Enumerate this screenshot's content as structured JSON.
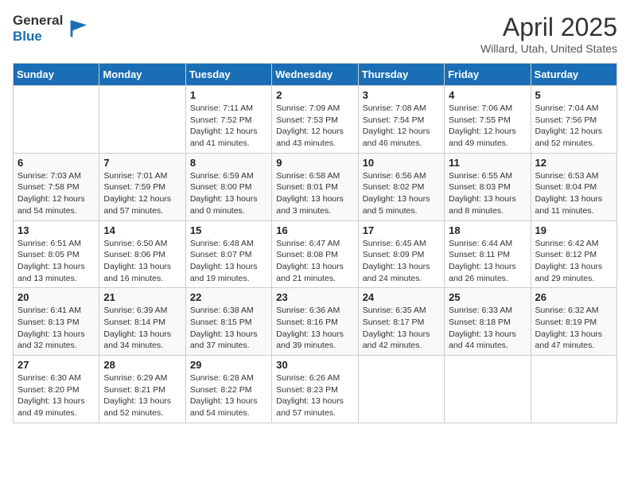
{
  "logo": {
    "line1": "General",
    "line2": "Blue"
  },
  "title": "April 2025",
  "subtitle": "Willard, Utah, United States",
  "days_of_week": [
    "Sunday",
    "Monday",
    "Tuesday",
    "Wednesday",
    "Thursday",
    "Friday",
    "Saturday"
  ],
  "weeks": [
    [
      {
        "num": "",
        "detail": ""
      },
      {
        "num": "",
        "detail": ""
      },
      {
        "num": "1",
        "detail": "Sunrise: 7:11 AM\nSunset: 7:52 PM\nDaylight: 12 hours and 41 minutes."
      },
      {
        "num": "2",
        "detail": "Sunrise: 7:09 AM\nSunset: 7:53 PM\nDaylight: 12 hours and 43 minutes."
      },
      {
        "num": "3",
        "detail": "Sunrise: 7:08 AM\nSunset: 7:54 PM\nDaylight: 12 hours and 46 minutes."
      },
      {
        "num": "4",
        "detail": "Sunrise: 7:06 AM\nSunset: 7:55 PM\nDaylight: 12 hours and 49 minutes."
      },
      {
        "num": "5",
        "detail": "Sunrise: 7:04 AM\nSunset: 7:56 PM\nDaylight: 12 hours and 52 minutes."
      }
    ],
    [
      {
        "num": "6",
        "detail": "Sunrise: 7:03 AM\nSunset: 7:58 PM\nDaylight: 12 hours and 54 minutes."
      },
      {
        "num": "7",
        "detail": "Sunrise: 7:01 AM\nSunset: 7:59 PM\nDaylight: 12 hours and 57 minutes."
      },
      {
        "num": "8",
        "detail": "Sunrise: 6:59 AM\nSunset: 8:00 PM\nDaylight: 13 hours and 0 minutes."
      },
      {
        "num": "9",
        "detail": "Sunrise: 6:58 AM\nSunset: 8:01 PM\nDaylight: 13 hours and 3 minutes."
      },
      {
        "num": "10",
        "detail": "Sunrise: 6:56 AM\nSunset: 8:02 PM\nDaylight: 13 hours and 5 minutes."
      },
      {
        "num": "11",
        "detail": "Sunrise: 6:55 AM\nSunset: 8:03 PM\nDaylight: 13 hours and 8 minutes."
      },
      {
        "num": "12",
        "detail": "Sunrise: 6:53 AM\nSunset: 8:04 PM\nDaylight: 13 hours and 11 minutes."
      }
    ],
    [
      {
        "num": "13",
        "detail": "Sunrise: 6:51 AM\nSunset: 8:05 PM\nDaylight: 13 hours and 13 minutes."
      },
      {
        "num": "14",
        "detail": "Sunrise: 6:50 AM\nSunset: 8:06 PM\nDaylight: 13 hours and 16 minutes."
      },
      {
        "num": "15",
        "detail": "Sunrise: 6:48 AM\nSunset: 8:07 PM\nDaylight: 13 hours and 19 minutes."
      },
      {
        "num": "16",
        "detail": "Sunrise: 6:47 AM\nSunset: 8:08 PM\nDaylight: 13 hours and 21 minutes."
      },
      {
        "num": "17",
        "detail": "Sunrise: 6:45 AM\nSunset: 8:09 PM\nDaylight: 13 hours and 24 minutes."
      },
      {
        "num": "18",
        "detail": "Sunrise: 6:44 AM\nSunset: 8:11 PM\nDaylight: 13 hours and 26 minutes."
      },
      {
        "num": "19",
        "detail": "Sunrise: 6:42 AM\nSunset: 8:12 PM\nDaylight: 13 hours and 29 minutes."
      }
    ],
    [
      {
        "num": "20",
        "detail": "Sunrise: 6:41 AM\nSunset: 8:13 PM\nDaylight: 13 hours and 32 minutes."
      },
      {
        "num": "21",
        "detail": "Sunrise: 6:39 AM\nSunset: 8:14 PM\nDaylight: 13 hours and 34 minutes."
      },
      {
        "num": "22",
        "detail": "Sunrise: 6:38 AM\nSunset: 8:15 PM\nDaylight: 13 hours and 37 minutes."
      },
      {
        "num": "23",
        "detail": "Sunrise: 6:36 AM\nSunset: 8:16 PM\nDaylight: 13 hours and 39 minutes."
      },
      {
        "num": "24",
        "detail": "Sunrise: 6:35 AM\nSunset: 8:17 PM\nDaylight: 13 hours and 42 minutes."
      },
      {
        "num": "25",
        "detail": "Sunrise: 6:33 AM\nSunset: 8:18 PM\nDaylight: 13 hours and 44 minutes."
      },
      {
        "num": "26",
        "detail": "Sunrise: 6:32 AM\nSunset: 8:19 PM\nDaylight: 13 hours and 47 minutes."
      }
    ],
    [
      {
        "num": "27",
        "detail": "Sunrise: 6:30 AM\nSunset: 8:20 PM\nDaylight: 13 hours and 49 minutes."
      },
      {
        "num": "28",
        "detail": "Sunrise: 6:29 AM\nSunset: 8:21 PM\nDaylight: 13 hours and 52 minutes."
      },
      {
        "num": "29",
        "detail": "Sunrise: 6:28 AM\nSunset: 8:22 PM\nDaylight: 13 hours and 54 minutes."
      },
      {
        "num": "30",
        "detail": "Sunrise: 6:26 AM\nSunset: 8:23 PM\nDaylight: 13 hours and 57 minutes."
      },
      {
        "num": "",
        "detail": ""
      },
      {
        "num": "",
        "detail": ""
      },
      {
        "num": "",
        "detail": ""
      }
    ]
  ]
}
